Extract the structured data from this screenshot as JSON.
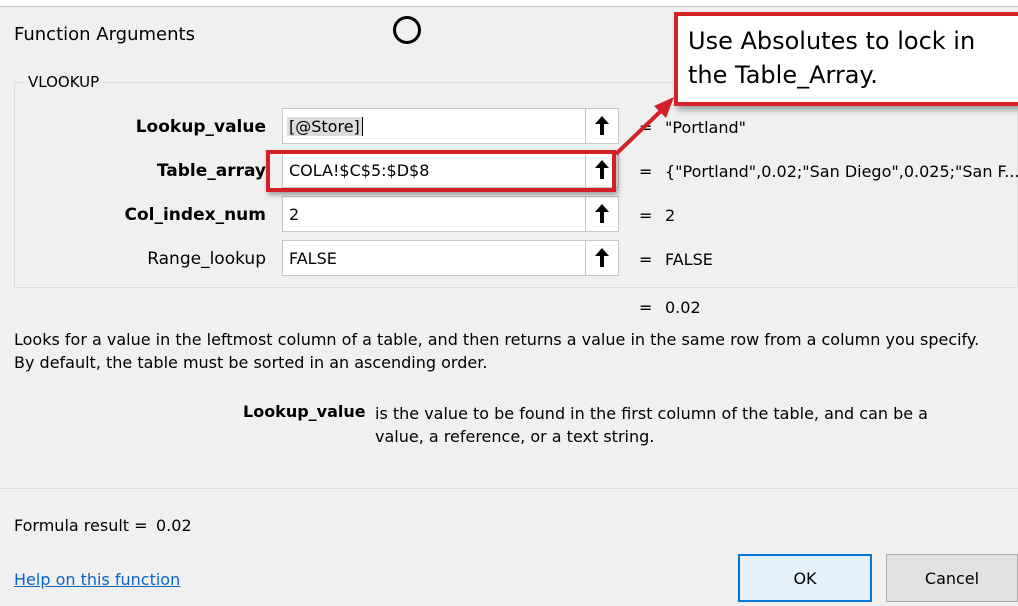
{
  "dialog": {
    "title": "Function Arguments",
    "function_name": "VLOOKUP"
  },
  "arguments": [
    {
      "label": "Lookup_value",
      "value": "[@Store]",
      "result": "\"Portland\""
    },
    {
      "label": "Table_array",
      "value": "COLA!$C$5:$D$8",
      "result": "{\"Portland\",0.02;\"San Diego\",0.025;\"San F..."
    },
    {
      "label": "Col_index_num",
      "value": "2",
      "result": "2"
    },
    {
      "label": "Range_lookup",
      "value": "FALSE",
      "result": "FALSE"
    }
  ],
  "equals": "=",
  "overall_result": "0.02",
  "description": "Looks for a value in the leftmost column of a table, and then returns a value in the same row from a column you specify. By default, the table must be sorted in an ascending order.",
  "arg_help": {
    "name": "Lookup_value",
    "text": "is the value to be found in the first column of the table, and can be a value, a reference, or a text string."
  },
  "formula_result": {
    "label": "Formula result =",
    "value": "0.02"
  },
  "help_link": "Help on this function",
  "buttons": {
    "ok": "OK",
    "cancel": "Cancel"
  },
  "annotation": {
    "text": "Use Absolutes to lock in the Table_Array.",
    "color": "#d42027"
  },
  "icons": {
    "collapse": "collapse-dialog-arrow-up-icon",
    "cursor": "circle-cursor-icon"
  }
}
